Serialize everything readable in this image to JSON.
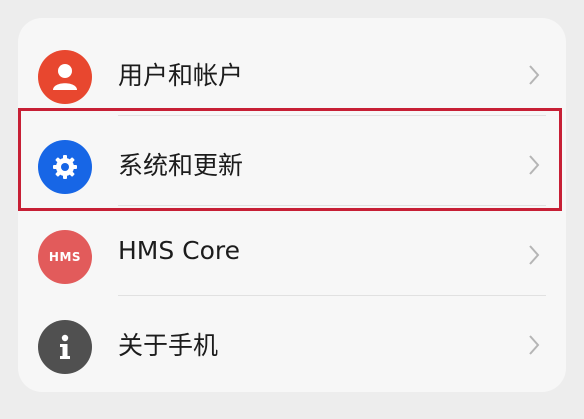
{
  "settings_list": {
    "items": [
      {
        "label": "用户和帐户",
        "icon": "user-icon",
        "icon_bg": "#e8472f"
      },
      {
        "label": "系统和更新",
        "icon": "gear-icon",
        "icon_bg": "#1766e6"
      },
      {
        "label": "HMS Core",
        "icon": "hms-icon",
        "icon_bg": "#e25b5b",
        "icon_text": "HMS"
      },
      {
        "label": "关于手机",
        "icon": "info-icon",
        "icon_bg": "#505050"
      }
    ],
    "highlight_color": "#c71f35"
  }
}
